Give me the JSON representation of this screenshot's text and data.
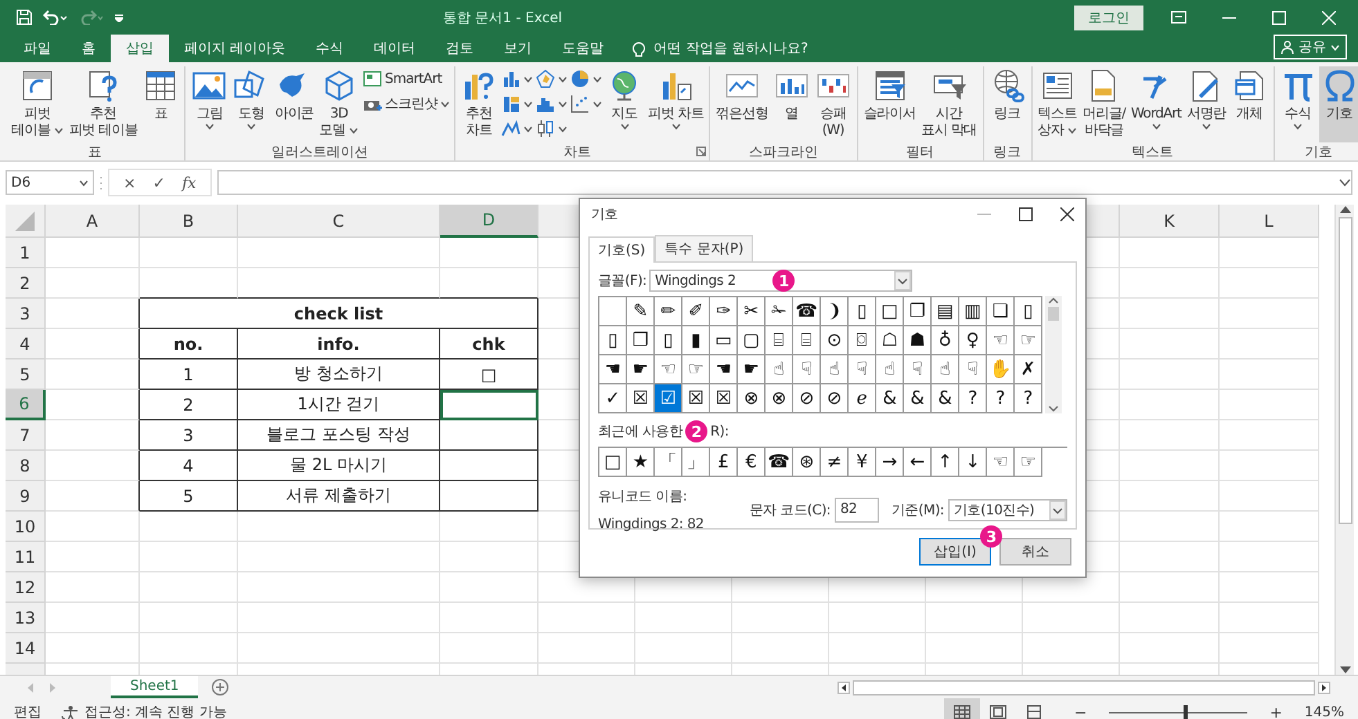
{
  "window": {
    "title": "통합 문서1 - Excel",
    "login": "로그인"
  },
  "quick_access": [
    {
      "kind": "save",
      "disabled": false
    },
    {
      "kind": "undo",
      "disabled": false
    },
    {
      "kind": "redo",
      "disabled": true
    },
    {
      "kind": "customize",
      "disabled": false
    }
  ],
  "ribbon_tabs": [
    {
      "label": "파일",
      "selected": false
    },
    {
      "label": "홈",
      "selected": false
    },
    {
      "label": "삽입",
      "selected": true
    },
    {
      "label": "페이지 레이아웃",
      "selected": false
    },
    {
      "label": "수식",
      "selected": false
    },
    {
      "label": "데이터",
      "selected": false
    },
    {
      "label": "검토",
      "selected": false
    },
    {
      "label": "보기",
      "selected": false
    },
    {
      "label": "도움말",
      "selected": false
    }
  ],
  "tell_me": {
    "placeholder": "어떤 작업을 원하시나요?"
  },
  "share_button": "공유",
  "ribbon_groups": [
    {
      "label": "표",
      "launcher": false,
      "items": [
        {
          "label": "피벗\n테이블",
          "kind": "large",
          "dropdown": true,
          "pressed": false
        },
        {
          "label": "추천\n피벗 테이블",
          "kind": "large",
          "dropdown": false,
          "pressed": false
        },
        {
          "label": "표",
          "kind": "large",
          "dropdown": false,
          "pressed": false
        }
      ]
    },
    {
      "label": "일러스트레이션",
      "launcher": false,
      "items": [
        {
          "label": "그림",
          "kind": "large",
          "dropdown": true,
          "pressed": false
        },
        {
          "label": "도형",
          "kind": "large",
          "dropdown": true,
          "pressed": false
        },
        {
          "label": "아이콘",
          "kind": "large",
          "dropdown": false,
          "pressed": false
        },
        {
          "label": "3D\n모델",
          "kind": "large",
          "dropdown": true,
          "pressed": false
        },
        {
          "label": "SmartArt",
          "kind": "small",
          "dropdown": false,
          "pressed": false
        },
        {
          "label": "스크린샷",
          "kind": "small",
          "dropdown": true,
          "pressed": false
        }
      ]
    },
    {
      "label": "차트",
      "launcher": true,
      "items": [
        {
          "label": "추천\n차트",
          "kind": "large",
          "dropdown": false,
          "pressed": false
        },
        {
          "kind": "mini",
          "dropdown": true,
          "pressed": false
        },
        {
          "kind": "mini",
          "dropdown": true,
          "pressed": false
        },
        {
          "kind": "mini",
          "dropdown": true,
          "pressed": false
        },
        {
          "kind": "mini",
          "dropdown": true,
          "pressed": false
        },
        {
          "kind": "mini",
          "dropdown": true,
          "pressed": false
        },
        {
          "kind": "mini",
          "dropdown": true,
          "pressed": false
        },
        {
          "kind": "mini",
          "dropdown": true,
          "pressed": false
        },
        {
          "kind": "mini",
          "dropdown": true,
          "pressed": false
        },
        {
          "label": "지도",
          "kind": "large",
          "dropdown": true,
          "pressed": false
        },
        {
          "label": "피벗 차트",
          "kind": "large",
          "dropdown": true,
          "pressed": false
        }
      ]
    },
    {
      "label": "스파크라인",
      "launcher": false,
      "items": [
        {
          "label": "꺾은선형",
          "kind": "large",
          "dropdown": false,
          "pressed": false
        },
        {
          "label": "열",
          "kind": "large",
          "dropdown": false,
          "pressed": false
        },
        {
          "label": "승패\n(W)",
          "kind": "large",
          "dropdown": false,
          "pressed": false
        }
      ]
    },
    {
      "label": "필터",
      "launcher": false,
      "items": [
        {
          "label": "슬라이서",
          "kind": "large",
          "dropdown": false,
          "pressed": false
        },
        {
          "label": "시간\n표시 막대",
          "kind": "large",
          "dropdown": false,
          "pressed": false
        }
      ]
    },
    {
      "label": "링크",
      "launcher": false,
      "items": [
        {
          "label": "링크",
          "kind": "large",
          "dropdown": false,
          "pressed": false
        }
      ]
    },
    {
      "label": "텍스트",
      "launcher": false,
      "items": [
        {
          "label": "텍스트\n상자",
          "kind": "large",
          "dropdown": true,
          "pressed": false
        },
        {
          "label": "머리글/\n바닥글",
          "kind": "large",
          "dropdown": false,
          "pressed": false
        },
        {
          "label": "WordArt",
          "kind": "large",
          "dropdown": true,
          "pressed": false
        },
        {
          "label": "서명란",
          "kind": "large",
          "dropdown": true,
          "pressed": false
        },
        {
          "label": "개체",
          "kind": "large",
          "dropdown": false,
          "pressed": false
        }
      ]
    },
    {
      "label": "기호",
      "launcher": false,
      "items": [
        {
          "label": "수식",
          "kind": "large",
          "dropdown": true,
          "pressed": false
        },
        {
          "label": "기호",
          "kind": "large",
          "dropdown": false,
          "pressed": true
        }
      ]
    }
  ],
  "formula_bar": {
    "name_box": "D6",
    "cancel": "×",
    "enter": "✓",
    "function": "fx"
  },
  "sheet": {
    "columns_left": [
      {
        "label": "A",
        "selected": false
      },
      {
        "label": "B",
        "selected": false
      },
      {
        "label": "C",
        "selected": false
      },
      {
        "label": "D",
        "selected": true
      }
    ],
    "columns_right": [
      {
        "label": "K",
        "selected": false
      },
      {
        "label": "L",
        "selected": false
      }
    ],
    "rows": [
      {
        "label": "1",
        "selected": false
      },
      {
        "label": "2",
        "selected": false
      },
      {
        "label": "3",
        "selected": false
      },
      {
        "label": "4",
        "selected": false
      },
      {
        "label": "5",
        "selected": false
      },
      {
        "label": "6",
        "selected": true
      },
      {
        "label": "7",
        "selected": false
      },
      {
        "label": "8",
        "selected": false
      },
      {
        "label": "9",
        "selected": false
      },
      {
        "label": "10",
        "selected": false
      },
      {
        "label": "11",
        "selected": false
      },
      {
        "label": "12",
        "selected": false
      },
      {
        "label": "13",
        "selected": false
      },
      {
        "label": "14",
        "selected": false
      }
    ],
    "check_list": {
      "title": "check list",
      "headers": [
        "no.",
        "info.",
        "chk"
      ],
      "rows": [
        {
          "no": "1",
          "info": "방 청소하기",
          "chk": "□",
          "selected": false
        },
        {
          "no": "2",
          "info": "1시간 걷기",
          "selected": true
        },
        {
          "no": "3",
          "info": "블로그 포스팅 작성",
          "selected": false
        },
        {
          "no": "4",
          "info": "물 2L 마시기",
          "selected": false
        },
        {
          "no": "5",
          "info": "서류 제출하기",
          "selected": false
        }
      ]
    }
  },
  "symbol_dialog": {
    "title": "기호",
    "tabs": [
      {
        "label": "기호(S)",
        "selected": true
      },
      {
        "label": "특수 문자(P)",
        "selected": false
      }
    ],
    "font_label": "글꼴(F):",
    "font_value": "Wingdings 2",
    "font_marker": "1",
    "symbols": [
      [
        {
          "selected": false
        },
        {
          "ch": "✎",
          "selected": false
        },
        {
          "ch": "✏",
          "selected": false
        },
        {
          "ch": "✐",
          "selected": false
        },
        {
          "ch": "✑",
          "selected": false
        },
        {
          "ch": "✂",
          "selected": false
        },
        {
          "ch": "✁",
          "selected": false
        },
        {
          "ch": "☎",
          "selected": false
        },
        {
          "ch": "❩",
          "selected": false
        },
        {
          "ch": "▯",
          "selected": false
        },
        {
          "ch": "□",
          "selected": false
        },
        {
          "ch": "❐",
          "selected": false
        },
        {
          "ch": "▤",
          "selected": false
        },
        {
          "ch": "▥",
          "selected": false
        },
        {
          "ch": "❏",
          "selected": false
        },
        {
          "ch": "▯",
          "selected": false
        }
      ],
      [
        {
          "ch": "▯",
          "selected": false
        },
        {
          "ch": "❒",
          "selected": false
        },
        {
          "ch": "▯",
          "selected": false
        },
        {
          "ch": "▮",
          "selected": false
        },
        {
          "ch": "▭",
          "selected": false
        },
        {
          "ch": "▢",
          "selected": false
        },
        {
          "ch": "⌸",
          "selected": false
        },
        {
          "ch": "⌸",
          "selected": false
        },
        {
          "ch": "⊙",
          "selected": false
        },
        {
          "ch": "⌼",
          "selected": false
        },
        {
          "ch": "☖",
          "selected": false
        },
        {
          "ch": "☗",
          "selected": false
        },
        {
          "ch": "♁",
          "selected": false
        },
        {
          "ch": "♀",
          "selected": false
        },
        {
          "ch": "☜",
          "selected": false
        },
        {
          "ch": "☞",
          "selected": false
        }
      ],
      [
        {
          "ch": "☚",
          "selected": false
        },
        {
          "ch": "☛",
          "selected": false
        },
        {
          "ch": "☜",
          "selected": false
        },
        {
          "ch": "☞",
          "selected": false
        },
        {
          "ch": "☚",
          "selected": false
        },
        {
          "ch": "☛",
          "selected": false
        },
        {
          "ch": "☝",
          "selected": false
        },
        {
          "ch": "☟",
          "selected": false
        },
        {
          "ch": "☝",
          "selected": false
        },
        {
          "ch": "☟",
          "selected": false
        },
        {
          "ch": "☝",
          "selected": false
        },
        {
          "ch": "☟",
          "selected": false
        },
        {
          "ch": "☝",
          "selected": false
        },
        {
          "ch": "☟",
          "selected": false
        },
        {
          "ch": "✋",
          "selected": false
        },
        {
          "ch": "✗",
          "selected": false
        }
      ],
      [
        {
          "ch": "✓",
          "selected": false
        },
        {
          "ch": "☒",
          "selected": false
        },
        {
          "ch": "☑",
          "selected": true
        },
        {
          "ch": "☒",
          "selected": false
        },
        {
          "ch": "☒",
          "selected": false
        },
        {
          "ch": "⊗",
          "selected": false
        },
        {
          "ch": "⊗",
          "selected": false
        },
        {
          "ch": "⊘",
          "selected": false
        },
        {
          "ch": "⊘",
          "selected": false
        },
        {
          "ch": "ℯ",
          "selected": false
        },
        {
          "ch": "&",
          "selected": false
        },
        {
          "ch": "&",
          "selected": false
        },
        {
          "ch": "&",
          "selected": false
        },
        {
          "ch": "?",
          "selected": false
        },
        {
          "ch": "?",
          "selected": false
        },
        {
          "ch": "?",
          "selected": false
        }
      ]
    ],
    "recent_label": "최근에 사용한",
    "recent_marker": "2",
    "recent_label_tail": "R):",
    "recent": [
      "□",
      "★",
      "「",
      "」",
      "£",
      "€",
      "☎",
      "⊛",
      "≠",
      "¥",
      "→",
      "←",
      "↑",
      "↓",
      "☜",
      "☞"
    ],
    "unicode_name_label": "유니코드 이름:",
    "unicode_name": "Wingdings 2: 82",
    "char_code_label": "문자 코드(C):",
    "char_code": "82",
    "from_label": "기준(M):",
    "from_value": "기호(10진수)",
    "buttons": [
      {
        "label": "삽입(I)",
        "kind": "default"
      },
      {
        "label": "취소",
        "kind": "normal"
      }
    ],
    "insert_marker": "3"
  },
  "sheet_tabs": [
    {
      "label": "Sheet1",
      "selected": true
    }
  ],
  "status_bar": {
    "mode": "편집",
    "accessibility": "접근성: 계속 진행 가능",
    "views": [
      {
        "kind": "normal",
        "selected": true
      },
      {
        "kind": "layout",
        "selected": false
      },
      {
        "kind": "break",
        "selected": false
      }
    ],
    "zoom": {
      "minus": "−",
      "plus": "+",
      "level": 0.55,
      "percent": "145%"
    }
  }
}
